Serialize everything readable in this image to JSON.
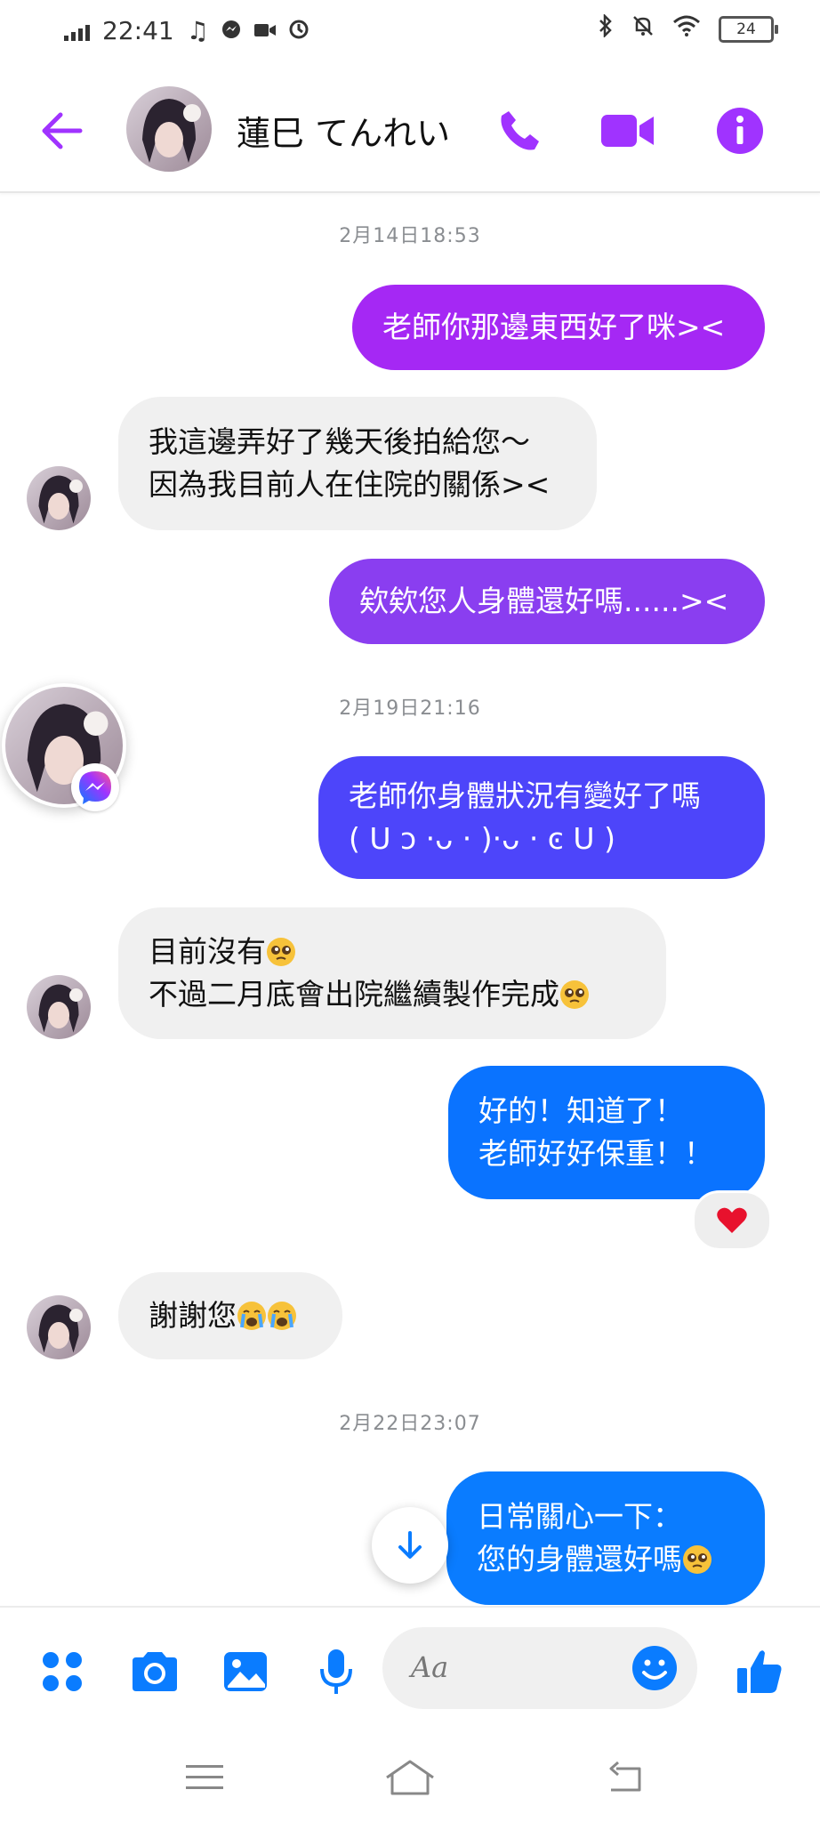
{
  "status_bar": {
    "time": "22:41",
    "battery": "24"
  },
  "header": {
    "contact_name": "蓮巳 てんれい"
  },
  "messages": {
    "ts1": "2月14日18:53",
    "m1": "老師你那邊東西好了咪><",
    "m2_l1": "我這邊弄好了幾天後拍給您～",
    "m2_l2": "因為我目前人在住院的關係><",
    "m3": "欸欸您人身體還好嗎......><",
    "ts2": "2月19日21:16",
    "m4_l1": "老師你身體狀況有變好了嗎",
    "m4_l2": "( U ͻ ·ᴗ · )·ᴗ · ͼ U )",
    "m5_l1": "目前沒有",
    "m5_l2": "不過二月底會出院繼續製作完成",
    "m6_l1": "好的！知道了！",
    "m6_l2": "老師好好保重！！",
    "m7": "謝謝您",
    "ts3": "2月22日23:07",
    "m8_l1": "日常關心一下：",
    "m8_l2": "您的身體還好嗎"
  },
  "composer": {
    "placeholder": "Aa"
  },
  "colors": {
    "accent_purple": "#a033ff",
    "messenger_blue": "#0a7cff",
    "reaction_heart": "#e8112d"
  },
  "icons": [
    "back-arrow-icon",
    "phone-icon",
    "video-icon",
    "info-icon",
    "apps-icon",
    "camera-icon",
    "image-icon",
    "mic-icon",
    "emoji-icon",
    "like-icon",
    "messenger-badge-icon",
    "arrow-down-icon",
    "heart-icon",
    "menu-icon",
    "home-icon",
    "back-icon"
  ]
}
